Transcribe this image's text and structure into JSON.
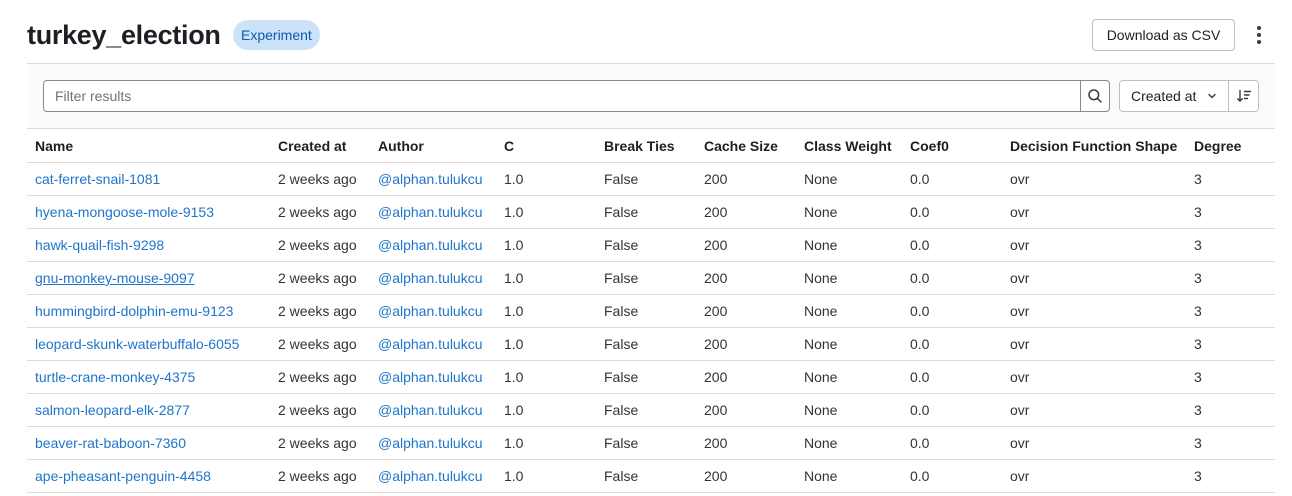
{
  "header": {
    "title": "turkey_election",
    "badge": "Experiment",
    "download_label": "Download as CSV",
    "more_icon": "kebab-vertical-icon"
  },
  "filter": {
    "placeholder": "Filter results",
    "value": "",
    "search_icon": "search-icon",
    "sort_label": "Created at",
    "sort_chevron_icon": "chevron-down-icon",
    "sort_direction_icon": "sort-descending-icon"
  },
  "table": {
    "columns": [
      "Name",
      "Created at",
      "Author",
      "C",
      "Break Ties",
      "Cache Size",
      "Class Weight",
      "Coef0",
      "Decision Function Shape",
      "Degree"
    ],
    "rows": [
      {
        "name": "cat-ferret-snail-1081",
        "created": "2 weeks ago",
        "author": "@alphan.tulukcu",
        "c": "1.0",
        "break_ties": "False",
        "cache_size": "200",
        "class_weight": "None",
        "coef0": "0.0",
        "dfs": "ovr",
        "degree": "3"
      },
      {
        "name": "hyena-mongoose-mole-9153",
        "created": "2 weeks ago",
        "author": "@alphan.tulukcu",
        "c": "1.0",
        "break_ties": "False",
        "cache_size": "200",
        "class_weight": "None",
        "coef0": "0.0",
        "dfs": "ovr",
        "degree": "3"
      },
      {
        "name": "hawk-quail-fish-9298",
        "created": "2 weeks ago",
        "author": "@alphan.tulukcu",
        "c": "1.0",
        "break_ties": "False",
        "cache_size": "200",
        "class_weight": "None",
        "coef0": "0.0",
        "dfs": "ovr",
        "degree": "3"
      },
      {
        "name": "gnu-monkey-mouse-9097",
        "created": "2 weeks ago",
        "author": "@alphan.tulukcu",
        "c": "1.0",
        "break_ties": "False",
        "cache_size": "200",
        "class_weight": "None",
        "coef0": "0.0",
        "dfs": "ovr",
        "degree": "3"
      },
      {
        "name": "hummingbird-dolphin-emu-9123",
        "created": "2 weeks ago",
        "author": "@alphan.tulukcu",
        "c": "1.0",
        "break_ties": "False",
        "cache_size": "200",
        "class_weight": "None",
        "coef0": "0.0",
        "dfs": "ovr",
        "degree": "3"
      },
      {
        "name": "leopard-skunk-waterbuffalo-6055",
        "created": "2 weeks ago",
        "author": "@alphan.tulukcu",
        "c": "1.0",
        "break_ties": "False",
        "cache_size": "200",
        "class_weight": "None",
        "coef0": "0.0",
        "dfs": "ovr",
        "degree": "3"
      },
      {
        "name": "turtle-crane-monkey-4375",
        "created": "2 weeks ago",
        "author": "@alphan.tulukcu",
        "c": "1.0",
        "break_ties": "False",
        "cache_size": "200",
        "class_weight": "None",
        "coef0": "0.0",
        "dfs": "ovr",
        "degree": "3"
      },
      {
        "name": "salmon-leopard-elk-2877",
        "created": "2 weeks ago",
        "author": "@alphan.tulukcu",
        "c": "1.0",
        "break_ties": "False",
        "cache_size": "200",
        "class_weight": "None",
        "coef0": "0.0",
        "dfs": "ovr",
        "degree": "3"
      },
      {
        "name": "beaver-rat-baboon-7360",
        "created": "2 weeks ago",
        "author": "@alphan.tulukcu",
        "c": "1.0",
        "break_ties": "False",
        "cache_size": "200",
        "class_weight": "None",
        "coef0": "0.0",
        "dfs": "ovr",
        "degree": "3"
      },
      {
        "name": "ape-pheasant-penguin-4458",
        "created": "2 weeks ago",
        "author": "@alphan.tulukcu",
        "c": "1.0",
        "break_ties": "False",
        "cache_size": "200",
        "class_weight": "None",
        "coef0": "0.0",
        "dfs": "ovr",
        "degree": "3"
      }
    ]
  }
}
